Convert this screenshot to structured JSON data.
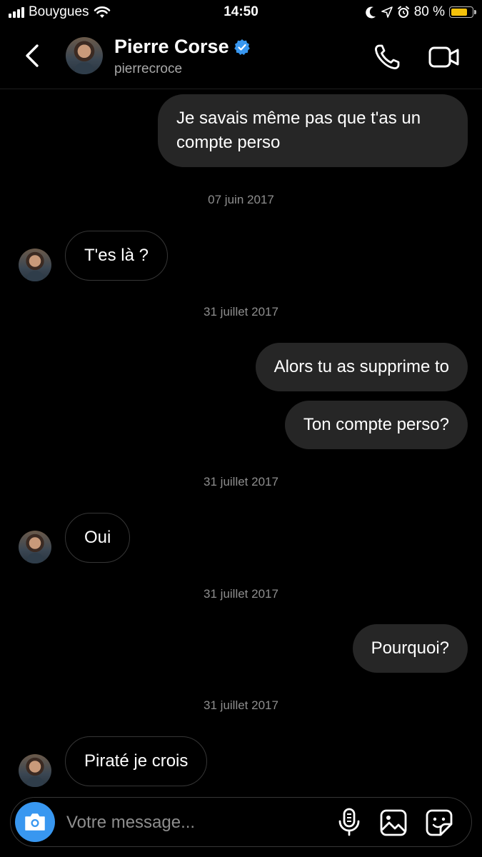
{
  "status_bar": {
    "carrier": "Bouygues",
    "time": "14:50",
    "battery": "80 %",
    "battery_level": 0.8,
    "battery_color": "#f5c20b"
  },
  "header": {
    "name": "Pierre Corse",
    "handle": "pierrecroce",
    "verified_color": "#3897f0",
    "icons": [
      "back-icon",
      "avatar",
      "verified-badge-icon",
      "phone-icon",
      "video-camera-icon"
    ]
  },
  "messages": [
    {
      "type": "sent",
      "text": "Je savais même pas que t'as un compte perso"
    },
    {
      "type": "date",
      "text": "07 juin 2017"
    },
    {
      "type": "received",
      "text": "T'es là ?"
    },
    {
      "type": "date",
      "text": "31 juillet 2017"
    },
    {
      "type": "sent",
      "text": "Alors tu as supprime to"
    },
    {
      "type": "sent",
      "text": "Ton compte perso?"
    },
    {
      "type": "date",
      "text": "31 juillet 2017"
    },
    {
      "type": "received",
      "text": "Oui"
    },
    {
      "type": "date",
      "text": "31 juillet 2017"
    },
    {
      "type": "sent",
      "text": "Pourquoi?"
    },
    {
      "type": "date",
      "text": "31 juillet 2017"
    },
    {
      "type": "received",
      "text": "Piraté je crois"
    }
  ],
  "composer": {
    "placeholder": "Votre message...",
    "camera_color": "#3897f0",
    "icons": [
      "camera-icon",
      "microphone-icon",
      "gallery-icon",
      "sticker-icon"
    ]
  }
}
